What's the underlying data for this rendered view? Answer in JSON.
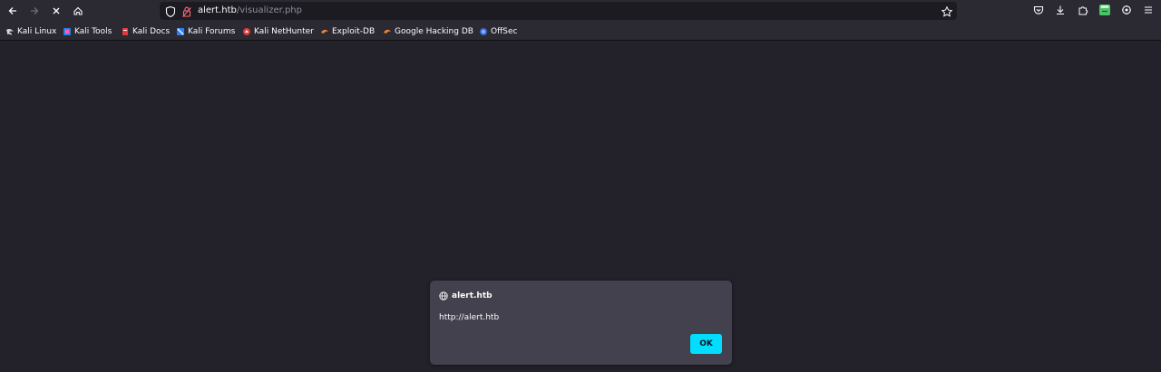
{
  "url": {
    "host": "alert.htb",
    "path": "/visualizer.php"
  },
  "bookmarks": [
    {
      "label": "Kali Linux",
      "icon": "kali-dragon-icon"
    },
    {
      "label": "Kali Tools",
      "icon": "kali-tools-icon"
    },
    {
      "label": "Kali Docs",
      "icon": "kali-docs-icon"
    },
    {
      "label": "Kali Forums",
      "icon": "kali-forums-icon"
    },
    {
      "label": "Kali NetHunter",
      "icon": "nethunter-icon"
    },
    {
      "label": "Exploit-DB",
      "icon": "exploit-db-icon"
    },
    {
      "label": "Google Hacking DB",
      "icon": "ghdb-icon"
    },
    {
      "label": "OffSec",
      "icon": "offsec-icon"
    }
  ],
  "dialog": {
    "title": "alert.htb",
    "message": "http://alert.htb",
    "ok_label": "OK"
  },
  "colors": {
    "accent": "#00ddff",
    "background": "#23222b",
    "toolbar": "#2b2a33",
    "dialog": "#42414d"
  }
}
